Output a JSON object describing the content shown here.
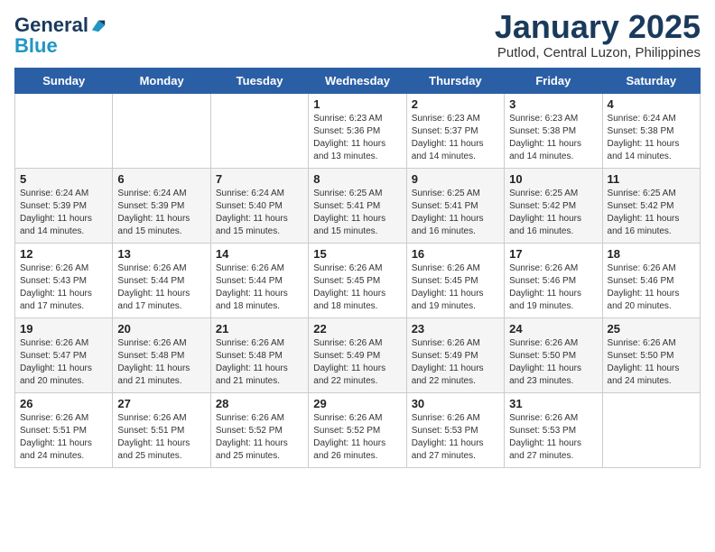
{
  "logo": {
    "line1": "General",
    "line2": "Blue"
  },
  "header": {
    "month": "January 2025",
    "location": "Putlod, Central Luzon, Philippines"
  },
  "weekdays": [
    "Sunday",
    "Monday",
    "Tuesday",
    "Wednesday",
    "Thursday",
    "Friday",
    "Saturday"
  ],
  "rows": [
    [
      {
        "day": "",
        "info": ""
      },
      {
        "day": "",
        "info": ""
      },
      {
        "day": "",
        "info": ""
      },
      {
        "day": "1",
        "info": "Sunrise: 6:23 AM\nSunset: 5:36 PM\nDaylight: 11 hours\nand 13 minutes."
      },
      {
        "day": "2",
        "info": "Sunrise: 6:23 AM\nSunset: 5:37 PM\nDaylight: 11 hours\nand 14 minutes."
      },
      {
        "day": "3",
        "info": "Sunrise: 6:23 AM\nSunset: 5:38 PM\nDaylight: 11 hours\nand 14 minutes."
      },
      {
        "day": "4",
        "info": "Sunrise: 6:24 AM\nSunset: 5:38 PM\nDaylight: 11 hours\nand 14 minutes."
      }
    ],
    [
      {
        "day": "5",
        "info": "Sunrise: 6:24 AM\nSunset: 5:39 PM\nDaylight: 11 hours\nand 14 minutes."
      },
      {
        "day": "6",
        "info": "Sunrise: 6:24 AM\nSunset: 5:39 PM\nDaylight: 11 hours\nand 15 minutes."
      },
      {
        "day": "7",
        "info": "Sunrise: 6:24 AM\nSunset: 5:40 PM\nDaylight: 11 hours\nand 15 minutes."
      },
      {
        "day": "8",
        "info": "Sunrise: 6:25 AM\nSunset: 5:41 PM\nDaylight: 11 hours\nand 15 minutes."
      },
      {
        "day": "9",
        "info": "Sunrise: 6:25 AM\nSunset: 5:41 PM\nDaylight: 11 hours\nand 16 minutes."
      },
      {
        "day": "10",
        "info": "Sunrise: 6:25 AM\nSunset: 5:42 PM\nDaylight: 11 hours\nand 16 minutes."
      },
      {
        "day": "11",
        "info": "Sunrise: 6:25 AM\nSunset: 5:42 PM\nDaylight: 11 hours\nand 16 minutes."
      }
    ],
    [
      {
        "day": "12",
        "info": "Sunrise: 6:26 AM\nSunset: 5:43 PM\nDaylight: 11 hours\nand 17 minutes."
      },
      {
        "day": "13",
        "info": "Sunrise: 6:26 AM\nSunset: 5:44 PM\nDaylight: 11 hours\nand 17 minutes."
      },
      {
        "day": "14",
        "info": "Sunrise: 6:26 AM\nSunset: 5:44 PM\nDaylight: 11 hours\nand 18 minutes."
      },
      {
        "day": "15",
        "info": "Sunrise: 6:26 AM\nSunset: 5:45 PM\nDaylight: 11 hours\nand 18 minutes."
      },
      {
        "day": "16",
        "info": "Sunrise: 6:26 AM\nSunset: 5:45 PM\nDaylight: 11 hours\nand 19 minutes."
      },
      {
        "day": "17",
        "info": "Sunrise: 6:26 AM\nSunset: 5:46 PM\nDaylight: 11 hours\nand 19 minutes."
      },
      {
        "day": "18",
        "info": "Sunrise: 6:26 AM\nSunset: 5:46 PM\nDaylight: 11 hours\nand 20 minutes."
      }
    ],
    [
      {
        "day": "19",
        "info": "Sunrise: 6:26 AM\nSunset: 5:47 PM\nDaylight: 11 hours\nand 20 minutes."
      },
      {
        "day": "20",
        "info": "Sunrise: 6:26 AM\nSunset: 5:48 PM\nDaylight: 11 hours\nand 21 minutes."
      },
      {
        "day": "21",
        "info": "Sunrise: 6:26 AM\nSunset: 5:48 PM\nDaylight: 11 hours\nand 21 minutes."
      },
      {
        "day": "22",
        "info": "Sunrise: 6:26 AM\nSunset: 5:49 PM\nDaylight: 11 hours\nand 22 minutes."
      },
      {
        "day": "23",
        "info": "Sunrise: 6:26 AM\nSunset: 5:49 PM\nDaylight: 11 hours\nand 22 minutes."
      },
      {
        "day": "24",
        "info": "Sunrise: 6:26 AM\nSunset: 5:50 PM\nDaylight: 11 hours\nand 23 minutes."
      },
      {
        "day": "25",
        "info": "Sunrise: 6:26 AM\nSunset: 5:50 PM\nDaylight: 11 hours\nand 24 minutes."
      }
    ],
    [
      {
        "day": "26",
        "info": "Sunrise: 6:26 AM\nSunset: 5:51 PM\nDaylight: 11 hours\nand 24 minutes."
      },
      {
        "day": "27",
        "info": "Sunrise: 6:26 AM\nSunset: 5:51 PM\nDaylight: 11 hours\nand 25 minutes."
      },
      {
        "day": "28",
        "info": "Sunrise: 6:26 AM\nSunset: 5:52 PM\nDaylight: 11 hours\nand 25 minutes."
      },
      {
        "day": "29",
        "info": "Sunrise: 6:26 AM\nSunset: 5:52 PM\nDaylight: 11 hours\nand 26 minutes."
      },
      {
        "day": "30",
        "info": "Sunrise: 6:26 AM\nSunset: 5:53 PM\nDaylight: 11 hours\nand 27 minutes."
      },
      {
        "day": "31",
        "info": "Sunrise: 6:26 AM\nSunset: 5:53 PM\nDaylight: 11 hours\nand 27 minutes."
      },
      {
        "day": "",
        "info": ""
      }
    ]
  ]
}
